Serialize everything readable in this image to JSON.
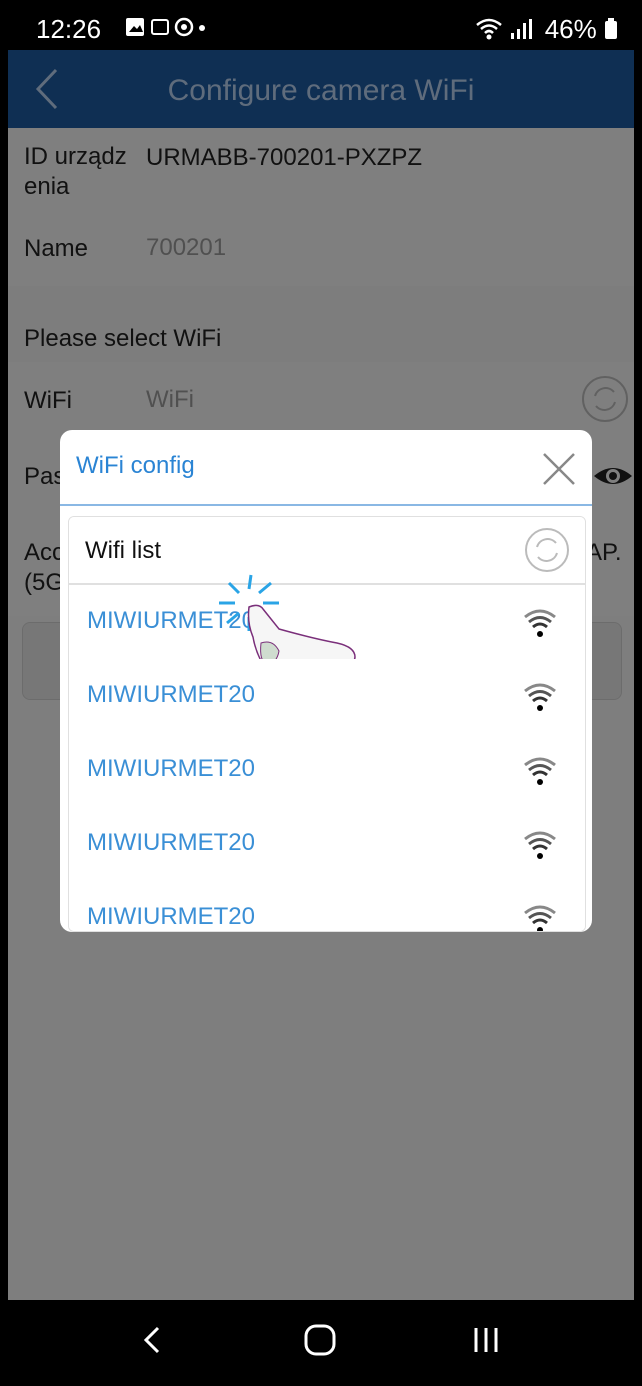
{
  "status": {
    "time": "12:26",
    "battery": "46%"
  },
  "appbar": {
    "title": "Configure camera WiFi"
  },
  "form": {
    "device_id_label": "ID urządz\nenia",
    "device_id_value": "URMABB-700201-PXZPZ",
    "name_label": "Name",
    "name_value": "700201",
    "select_wifi_text": "Please select WiFi",
    "wifi_label": "WiFi",
    "wifi_placeholder": "WiFi",
    "password_label_partial": "Pas",
    "access_text_partial": "Acc",
    "access_text_partial2": "(5G",
    "ap_text_partial": "AP."
  },
  "dialog": {
    "title": "WiFi config",
    "list_title": "Wifi list",
    "networks": [
      "MIWIURMET20",
      "MIWIURMET20",
      "MIWIURMET20",
      "MIWIURMET20",
      "MIWIURMET20"
    ]
  },
  "colors": {
    "accent": "#1e5aa0",
    "link": "#3a8fd6"
  },
  "icons": [
    "back-arrow-icon",
    "refresh-icon",
    "close-icon",
    "eye-icon",
    "wifi-signal-icon",
    "nav-back-icon",
    "nav-home-icon",
    "nav-recents-icon"
  ]
}
